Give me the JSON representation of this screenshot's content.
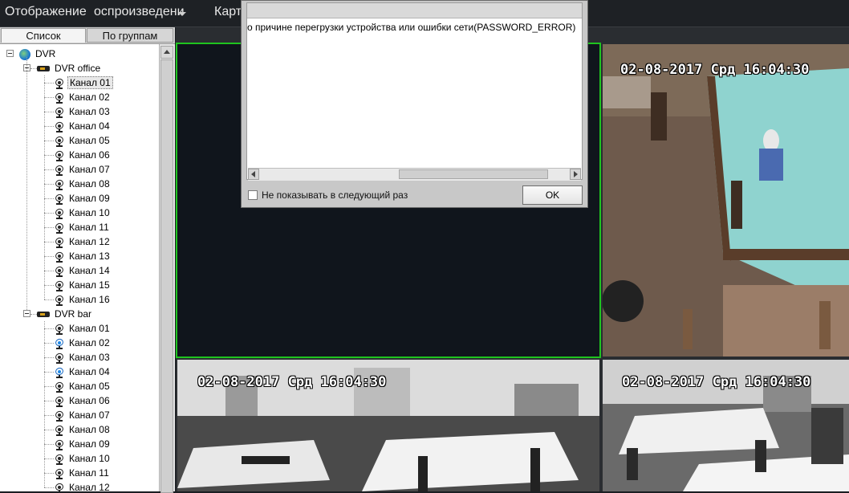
{
  "menu": {
    "items": [
      "Отображение",
      "оспроизведени",
      "Карт"
    ]
  },
  "left_panel": {
    "tabs": [
      "Список",
      "По группам"
    ],
    "active_tab": "Список",
    "root": "DVR",
    "groups": [
      {
        "name": "DVR office",
        "channels": [
          "Канал 01",
          "Канал 02",
          "Канал 03",
          "Канал 04",
          "Канал 05",
          "Канал 06",
          "Канал 07",
          "Канал 08",
          "Канал 09",
          "Канал 10",
          "Канал 11",
          "Канал 12",
          "Канал 13",
          "Канал 14",
          "Канал 15",
          "Канал 16"
        ],
        "selected": "Канал 01",
        "active_channels": []
      },
      {
        "name": "DVR bar",
        "channels": [
          "Канал 01",
          "Канал 02",
          "Канал 03",
          "Канал 04",
          "Канал 05",
          "Канал 06",
          "Канал 07",
          "Канал 08",
          "Канал 09",
          "Канал 10",
          "Канал 11",
          "Канал 12"
        ],
        "selected": "",
        "active_channels": [
          "Канал 02",
          "Канал 04"
        ]
      }
    ]
  },
  "video": {
    "panes": [
      {
        "id": "cam-top-right",
        "timestamp": "02-08-2017 Срд 16:04:30"
      },
      {
        "id": "cam-bottom-left",
        "timestamp": "02-08-2017 Срд 16:04:30"
      },
      {
        "id": "cam-bottom-right",
        "timestamp": "02-08-2017 Срд 16:04:30"
      }
    ],
    "selected_border_color": "#1fc41f"
  },
  "dialog": {
    "message": "о причине перегрузки устройства или ошибки сети(PASSWORD_ERROR)",
    "checkbox_label": "Не показывать в следующий раз",
    "checkbox_checked": false,
    "ok_label": "OK"
  }
}
